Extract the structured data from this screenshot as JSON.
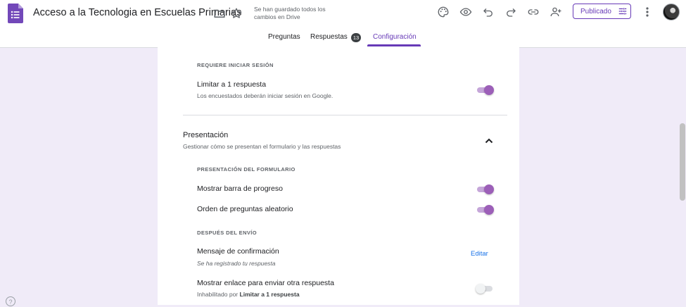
{
  "header": {
    "title": "Acceso a la Tecnologia en Escuelas Primarias",
    "save_status": "Se han guardado todos los cambios en Drive",
    "publish_label": "Publicado",
    "accent_color": "#673ab7",
    "icons": [
      "forms-logo-icon",
      "folder-icon",
      "star-icon",
      "palette-icon",
      "eye-preview-icon",
      "undo-icon",
      "redo-icon",
      "link-icon",
      "add-person-icon",
      "tune-icon",
      "more-vert-icon"
    ]
  },
  "tabs": [
    {
      "label": "Preguntas"
    },
    {
      "label": "Respuestas",
      "badge": "13"
    },
    {
      "label": "Configuración",
      "active": true
    }
  ],
  "settings": {
    "login_caption": "REQUIERE INICIAR SESIÓN",
    "limit_one": {
      "title": "Limitar a 1 respuesta",
      "subtitle": "Los encuestados deberán iniciar sesión en Google.",
      "enabled": true
    },
    "presentation": {
      "title": "Presentación",
      "subtitle": "Gestionar cómo se presentan el formulario y las respuestas",
      "expanded": true
    },
    "form_presentation_caption": "PRESENTACIÓN DEL FORMULARIO",
    "progress_bar": {
      "title": "Mostrar barra de progreso",
      "enabled": true
    },
    "shuffle": {
      "title": "Orden de preguntas aleatorio",
      "enabled": true
    },
    "after_submit_caption": "DESPUÉS DEL ENVÍO",
    "confirmation": {
      "title": "Mensaje de confirmación",
      "subtitle": "Se ha registrado tu respuesta",
      "action": "Editar"
    },
    "resubmit_link": {
      "title": "Mostrar enlace para enviar otra respuesta",
      "subtitle_prefix": "Inhabilitado por",
      "subtitle_bold": "Limitar a 1 respuesta",
      "enabled": false
    }
  },
  "help_icon": "?"
}
